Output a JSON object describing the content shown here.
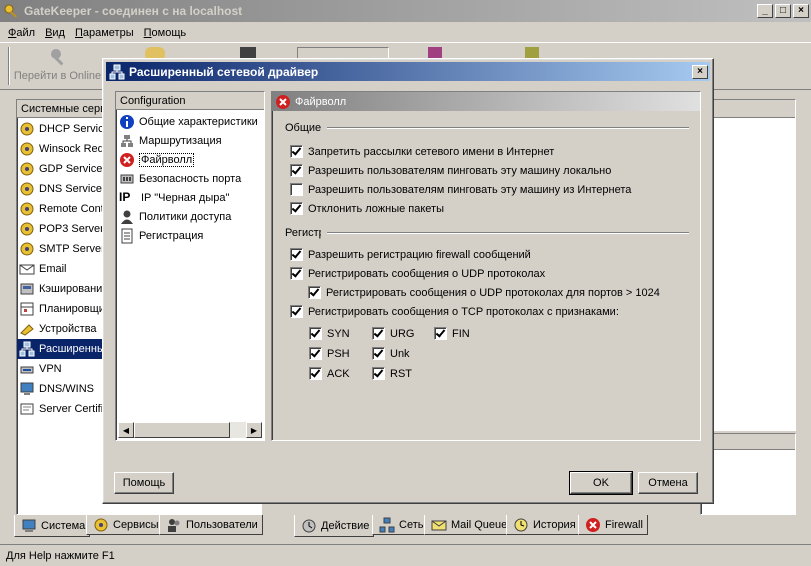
{
  "main_window": {
    "title": "GateKeeper - соединен с на localhost",
    "menu": [
      "Файл",
      "Вид",
      "Параметры",
      "Помощь"
    ],
    "toolbar": {
      "online_label": "Перейти в Online"
    },
    "left_header": "Системные сервисы",
    "services": [
      {
        "label": "DHCP Service",
        "icon": "dhcp-icon"
      },
      {
        "label": "Winsock Redirector",
        "icon": "winsock-icon"
      },
      {
        "label": "GDP Service",
        "icon": "gdp-icon"
      },
      {
        "label": "DNS Service",
        "icon": "dns-icon"
      },
      {
        "label": "Remote Control",
        "icon": "remote-icon"
      },
      {
        "label": "POP3 Server",
        "icon": "pop3-icon"
      },
      {
        "label": "SMTP Server",
        "icon": "smtp-icon"
      },
      {
        "label": "Email",
        "icon": "email-icon"
      },
      {
        "label": "Кэширование",
        "icon": "cache-icon"
      },
      {
        "label": "Планировщик",
        "icon": "scheduler-icon"
      },
      {
        "label": "Устройства",
        "icon": "devices-icon"
      },
      {
        "label": "Расширенный сетевой драйвер",
        "icon": "network-driver-icon"
      },
      {
        "label": "VPN",
        "icon": "vpn-icon"
      },
      {
        "label": "DNS/WINS",
        "icon": "dnswins-icon"
      },
      {
        "label": "Server Certificate",
        "icon": "certificate-icon"
      }
    ],
    "left_tabs": [
      "Система",
      "Сервисы",
      "Пользователи"
    ],
    "right_tabs": [
      "Действие",
      "Сеть",
      "Mail Queue",
      "История",
      "Firewall"
    ],
    "status_bar": "Для Help нажмите F1"
  },
  "dialog": {
    "title": "Расширенный сетевой драйвер",
    "tree_header": "Configuration",
    "tree": [
      {
        "label": "Общие характеристики"
      },
      {
        "label": "Маршрутизация"
      },
      {
        "label": "Файрволл"
      },
      {
        "label": "Безопасность порта"
      },
      {
        "label": "IP \"Черная дыра\""
      },
      {
        "label": "Политики доступа"
      },
      {
        "label": "Регистрация"
      }
    ],
    "panel_title": "Файрволл",
    "general": {
      "label": "Общие",
      "options": [
        {
          "label": "Запретить рассылки сетевого имени в Интернет",
          "checked": true
        },
        {
          "label": "Разрешить пользователям пинговать эту машину локально",
          "checked": true
        },
        {
          "label": "Разрешить пользователям пинговать эту машину из Интернета",
          "checked": false
        },
        {
          "label": "Отклонить ложные пакеты",
          "checked": true
        }
      ]
    },
    "logging": {
      "label": "Регистрация",
      "allow_firewall": "Разрешить регистрацию firewall сообщений",
      "udp": "Регистрировать сообщения о UDP протоколах",
      "udp_ports": "Регистрировать сообщения о UDP протоколах для портов > 1024",
      "tcp": "Регистрировать сообщения о TCP протоколах с признаками:",
      "flags": {
        "syn": "SYN",
        "urg": "URG",
        "fin": "FIN",
        "psh": "PSH",
        "unk": "Unk",
        "ack": "ACK",
        "rst": "RST"
      }
    },
    "buttons": {
      "help": "Помощь",
      "ok": "OK",
      "cancel": "Отмена"
    }
  }
}
